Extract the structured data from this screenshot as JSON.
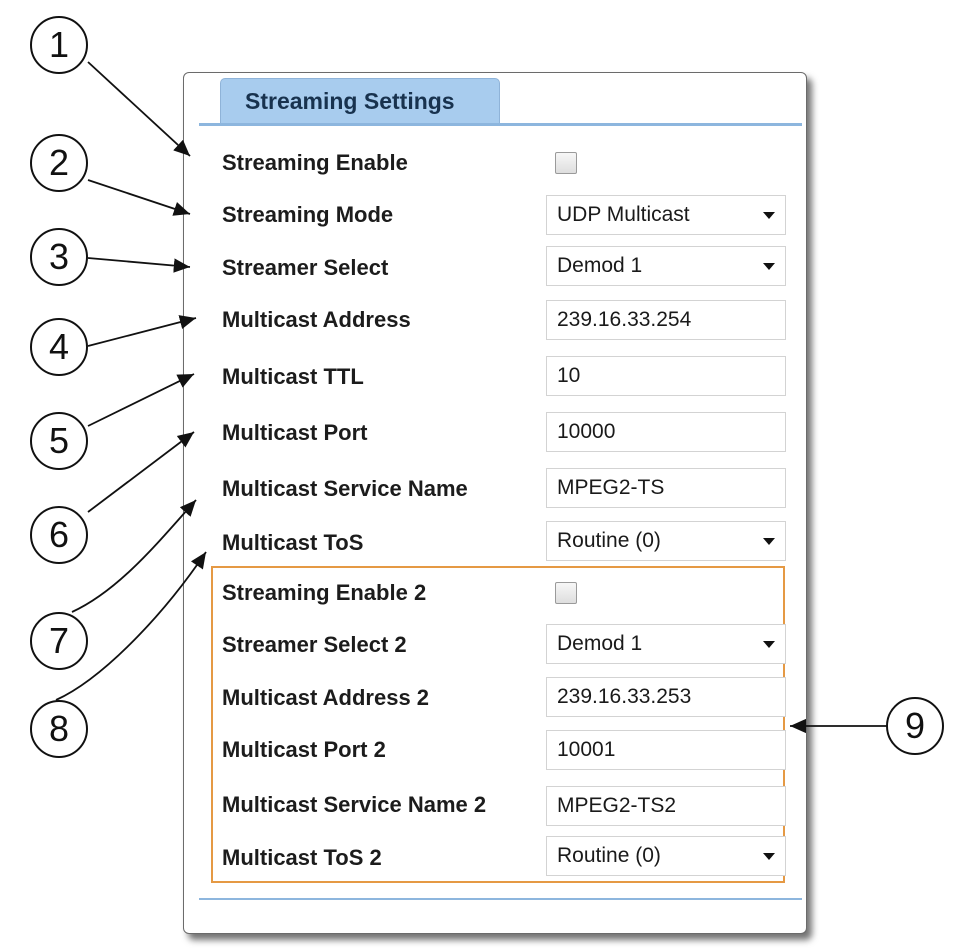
{
  "tab": {
    "label": "Streaming Settings"
  },
  "fields": [
    {
      "label": "Streaming Enable",
      "type": "checkbox",
      "checked": false
    },
    {
      "label": "Streaming Mode",
      "type": "select",
      "value": "UDP Multicast"
    },
    {
      "label": "Streamer Select",
      "type": "select",
      "value": "Demod 1"
    },
    {
      "label": "Multicast Address",
      "type": "text",
      "value": "239.16.33.254"
    },
    {
      "label": "Multicast TTL",
      "type": "text",
      "value": "10"
    },
    {
      "label": "Multicast Port",
      "type": "text",
      "value": "10000"
    },
    {
      "label": "Multicast Service Name",
      "type": "text",
      "value": "MPEG2-TS"
    },
    {
      "label": "Multicast ToS",
      "type": "select",
      "value": "Routine (0)"
    },
    {
      "label": "Streaming Enable 2",
      "type": "checkbox",
      "checked": false
    },
    {
      "label": "Streamer Select 2",
      "type": "select",
      "value": "Demod 1"
    },
    {
      "label": "Multicast Address 2",
      "type": "text",
      "value": "239.16.33.253"
    },
    {
      "label": "Multicast Port 2",
      "type": "text",
      "value": "10001"
    },
    {
      "label": "Multicast Service Name 2",
      "type": "text",
      "value": "MPEG2-TS2"
    },
    {
      "label": "Multicast ToS 2",
      "type": "select",
      "value": "Routine (0)"
    }
  ],
  "callouts": [
    "1",
    "2",
    "3",
    "4",
    "5",
    "6",
    "7",
    "8",
    "9"
  ],
  "colors": {
    "tab": "#a8ccee",
    "accent_line": "#8db6de",
    "group_border": "#e59944"
  }
}
